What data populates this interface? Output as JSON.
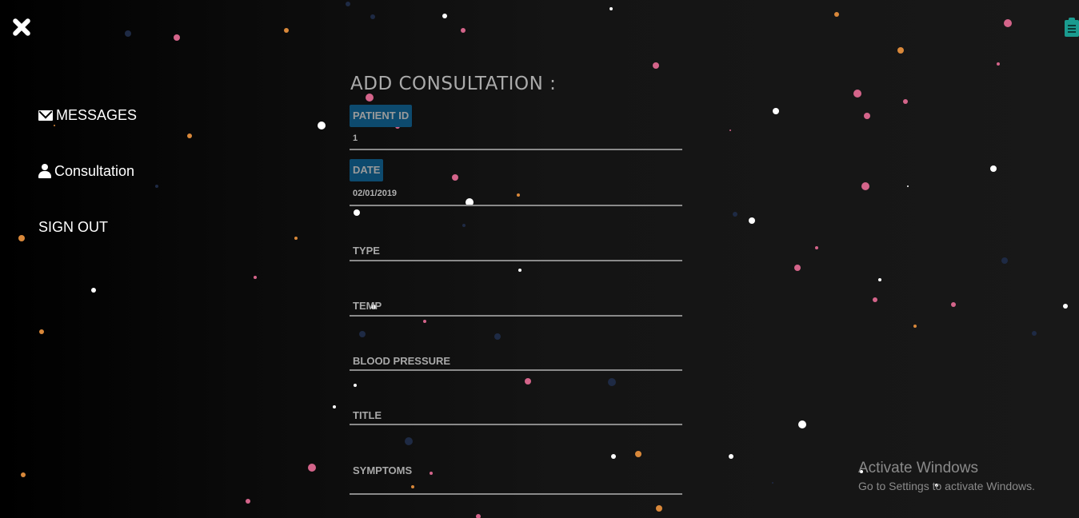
{
  "nav": {
    "items": [
      {
        "label": "MESSAGES",
        "icon": "envelope-icon"
      },
      {
        "label": "Consultation",
        "icon": "user-icon"
      },
      {
        "label": "SIGN OUT"
      }
    ]
  },
  "form": {
    "title": "ADD CONSULTATION :",
    "fields": {
      "patient_id": {
        "label": "PATIENT ID",
        "value": "1"
      },
      "date": {
        "label": "DATE",
        "value": "02/01/2019"
      },
      "type": {
        "label": "TYPE"
      },
      "temp": {
        "label": "TEMP"
      },
      "blood_pressure": {
        "label": "BLOOD PRESSURE"
      },
      "title": {
        "label": "TITLE"
      },
      "symptoms": {
        "label": "SYMPTOMS"
      }
    }
  },
  "watermark": {
    "title": "Activate Windows",
    "subtitle": "Go to Settings to activate Windows."
  },
  "colors": {
    "badge_bg": "#0d4a6e",
    "particle_pink": "#d4648a",
    "particle_orange": "#d9883a",
    "particle_white": "#ffffff",
    "particle_navy": "#1e2a44",
    "clipboard": "#1a9b8f"
  }
}
